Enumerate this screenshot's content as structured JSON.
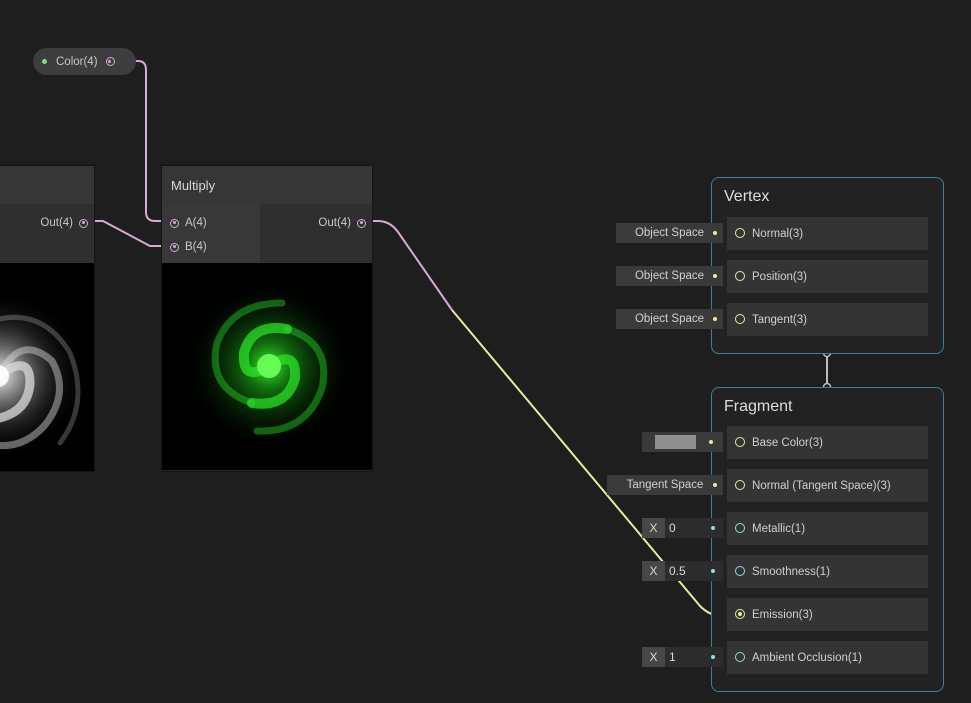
{
  "property_node": {
    "label": "Color(4)"
  },
  "left_node": {
    "output_label": "Out(4)"
  },
  "multiply_node": {
    "title": "Multiply",
    "input_a": "A(4)",
    "input_b": "B(4)",
    "output_label": "Out(4)"
  },
  "vertex": {
    "title": "Vertex",
    "blocks": [
      {
        "label": "Normal(3)",
        "space": "Object Space"
      },
      {
        "label": "Position(3)",
        "space": "Object Space"
      },
      {
        "label": "Tangent(3)",
        "space": "Object Space"
      }
    ]
  },
  "fragment": {
    "title": "Fragment",
    "base_color": {
      "label": "Base Color(3)",
      "swatch_color": "#8f8f8f"
    },
    "normal_ts": {
      "label": "Normal (Tangent Space)(3)",
      "space": "Tangent Space"
    },
    "metallic": {
      "label": "Metallic(1)",
      "x_label": "X",
      "value": "0"
    },
    "smoothness": {
      "label": "Smoothness(1)",
      "x_label": "X",
      "value": "0.5"
    },
    "emission": {
      "label": "Emission(3)"
    },
    "ambient_occlusion": {
      "label": "Ambient Occlusion(1)",
      "x_label": "X",
      "value": "1"
    }
  },
  "colors": {
    "wire_pink": "#d7a9d6",
    "wire_yellow": "#e9eb9c",
    "port_cyan": "#8be1ea",
    "context_border": "#3c7ea0",
    "background": "#1e1e1e"
  }
}
